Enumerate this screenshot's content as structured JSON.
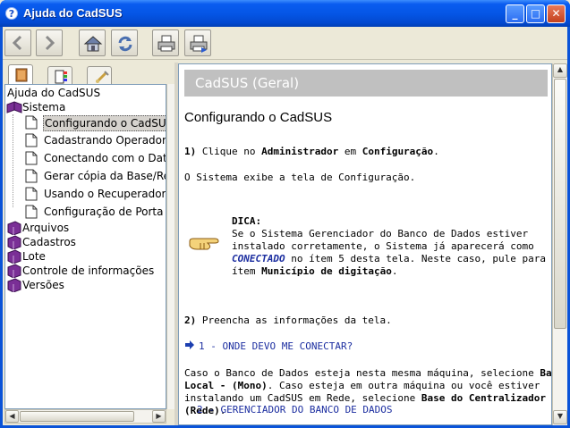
{
  "window": {
    "title": "Ajuda do CadSUS",
    "title_icon": "help-icon",
    "minimize": "_",
    "maximize": "□",
    "close": "✕"
  },
  "toolbar": {
    "buttons": [
      "back-icon",
      "forward-icon",
      "home-icon",
      "refresh-icon",
      "print-icon",
      "page-setup-icon"
    ]
  },
  "tabs": [
    "contents-tab-icon",
    "index-tab-icon",
    "search-tab-icon"
  ],
  "tree": {
    "root": "Ajuda do CadSUS",
    "sistema": "Sistema",
    "children": [
      "Configurando o CadSUS",
      "Cadastrando Operadores",
      "Conectando com o Datas",
      "Gerar cópia da Base/Rec",
      "Usando o Recuperador F",
      "Configuração de Porta pa"
    ],
    "folders": [
      "Arquivos",
      "Cadastros",
      "Lote",
      "Controle de informações",
      "Versões"
    ]
  },
  "content": {
    "banner": "CadSUS (Geral)",
    "heading": "Configurando o CadSUS",
    "step1_num": "1)",
    "step1_a": "Clique no",
    "step1_b": "Administrador",
    "step1_c": "em",
    "step1_d": "Configuração",
    "step1_e": ".",
    "system_shows": "O Sistema exibe a tela de Configuração.",
    "dica_label": "DICA:",
    "dica_1": "Se o Sistema Gerenciador do Banco de Dados estiver",
    "dica_2": "instalado corretamente, o Sistema já aparecerá como",
    "dica_3a": "CONECTADO",
    "dica_3b": " no ítem 5 desta tela. Neste caso, pule para o",
    "dica_4a": "ítem ",
    "dica_4b": "Município de digitação",
    "dica_4c": ".",
    "step2_num": "2)",
    "step2": "Preencha as informações da tela.",
    "link1": "1 - ONDE DEVO ME CONECTAR?",
    "para_1a": "Caso o Banco de Dados esteja nesta mesma máquina, selecione ",
    "para_1b": "Base",
    "para_2a": "Local - (Mono)",
    "para_2b": ". Caso esteja em outra máquina ou você estiver",
    "para_3a": "instalando um CadSUS em Rede, selecione ",
    "para_3b": "Base do Centralizador -",
    "para_4": "(Rede)",
    "para_4b": ".",
    "link2": "2 - GERENCIADOR DO BANCO DE DADOS"
  },
  "colors": {
    "titlebar": "#0556e6",
    "banner": "#c0c0c0",
    "link": "#1c2ea0",
    "book": "#6b2a8a"
  }
}
